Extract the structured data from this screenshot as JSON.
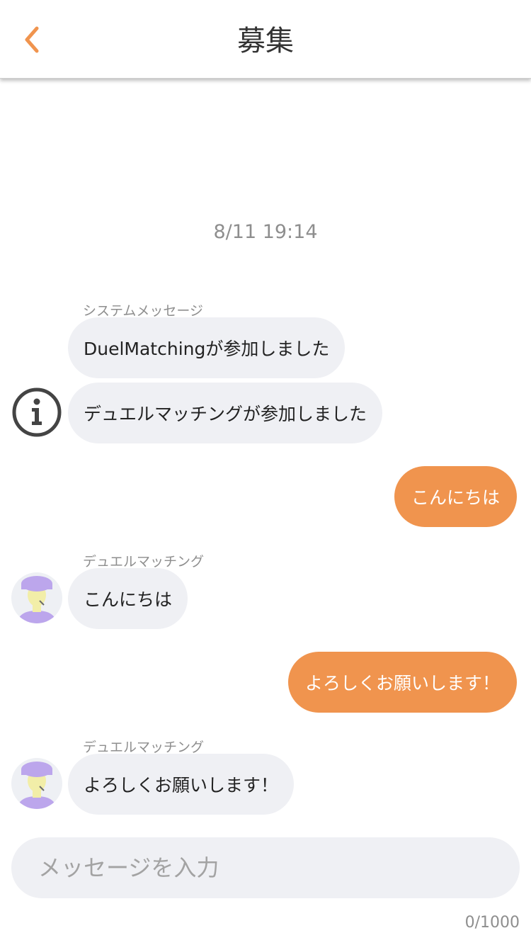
{
  "header": {
    "title": "募集",
    "back_icon": "chevron-left-icon"
  },
  "chat": {
    "timestamp": "8/11 19:14",
    "messages": [
      {
        "sender": "システムメッセージ",
        "direction": "in",
        "avatar": "info-icon",
        "text": "DuelMatchingが参加しました"
      },
      {
        "sender": "",
        "direction": "in",
        "avatar": "info-icon",
        "text": "デュエルマッチングが参加しました"
      },
      {
        "sender": "",
        "direction": "out",
        "text": "こんにちは"
      },
      {
        "sender": "デュエルマッチング",
        "direction": "in",
        "avatar": "user-avatar",
        "text": "こんにちは"
      },
      {
        "sender": "",
        "direction": "out",
        "text": "よろしくお願いします！"
      },
      {
        "sender": "デュエルマッチング",
        "direction": "in",
        "avatar": "user-avatar",
        "text": "よろしくお願いします！"
      }
    ]
  },
  "composer": {
    "placeholder": "メッセージを入力",
    "value": "",
    "counter": "0/1000"
  },
  "colors": {
    "accent": "#f0944e",
    "incoming_bubble": "#eff0f4",
    "muted_text": "#8e8e8e",
    "avatar_purple": "#bca6ec",
    "avatar_skin": "#f2eea8"
  }
}
